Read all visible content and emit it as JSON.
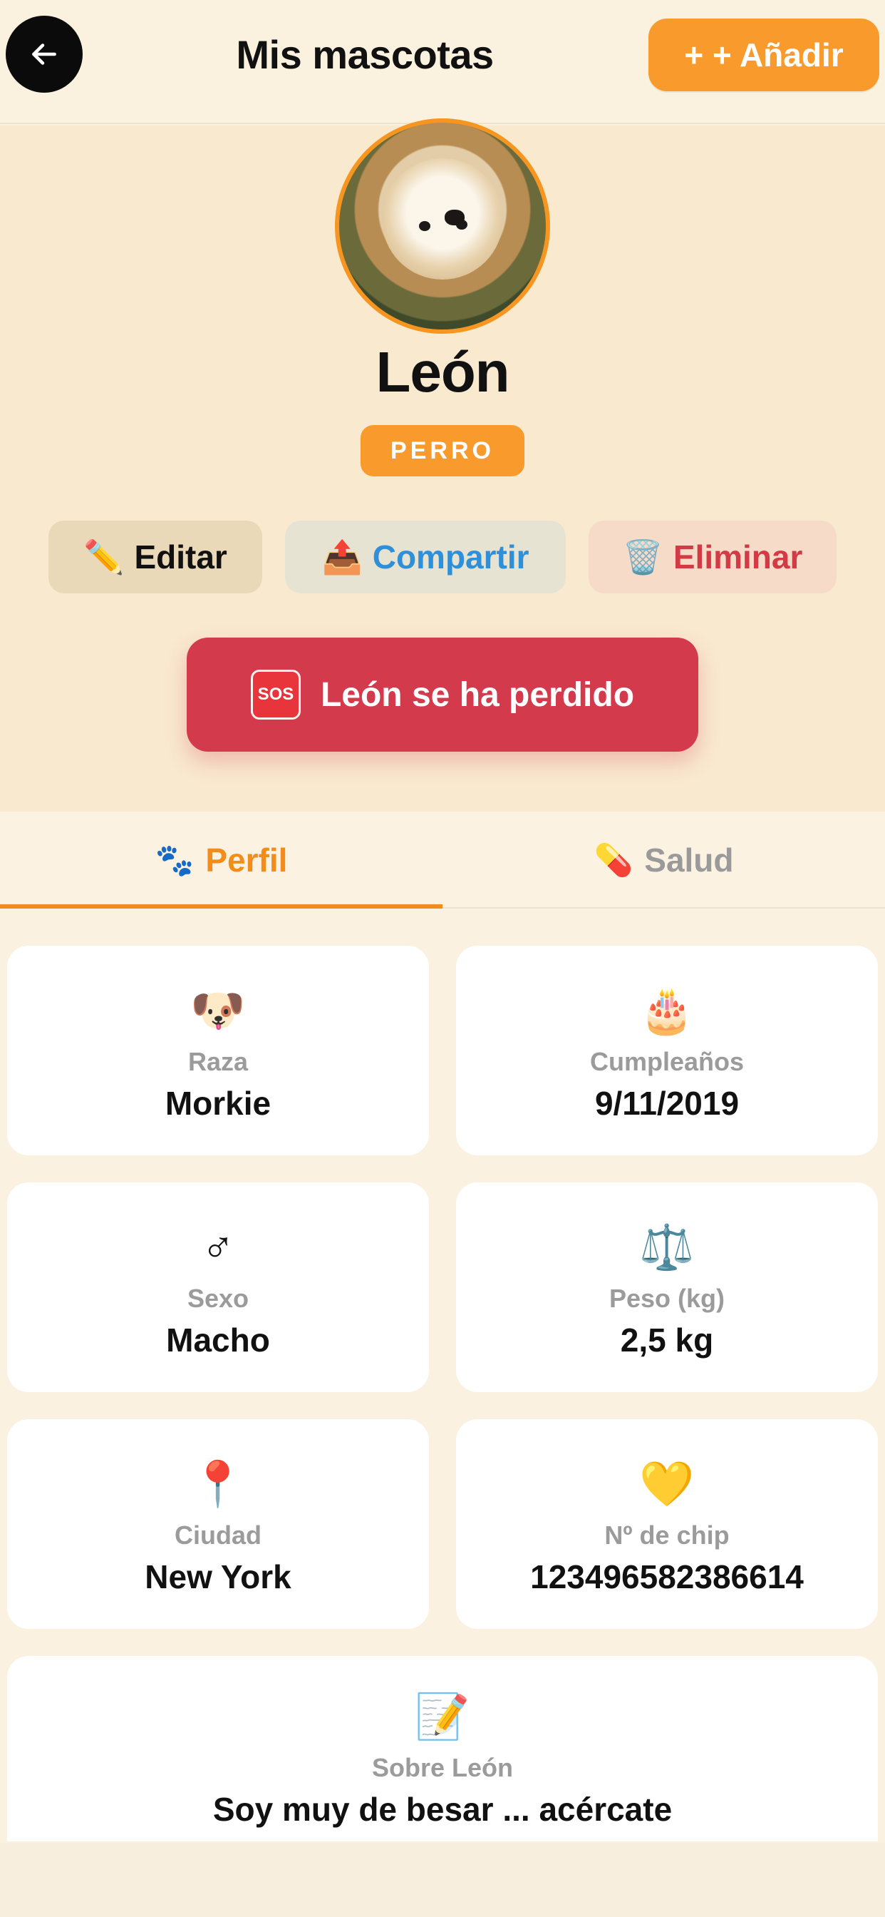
{
  "header": {
    "title": "Mis mascotas",
    "add_label": "+ + Añadir"
  },
  "pet": {
    "name": "León",
    "species": "PERRO"
  },
  "actions": {
    "edit": {
      "icon": "✏️",
      "label": "Editar"
    },
    "share": {
      "icon": "📤",
      "label": "Compartir"
    },
    "delete": {
      "icon": "🗑️",
      "label": "Eliminar"
    }
  },
  "sos": {
    "badge": "SOS",
    "label": "León  se ha perdido"
  },
  "tabs": [
    {
      "icon": "🐾",
      "label": "Perfil",
      "active": true
    },
    {
      "icon": "💊",
      "label": "Salud",
      "active": false
    }
  ],
  "profile": {
    "breed": {
      "icon": "🐶",
      "label": "Raza",
      "value": "Morkie"
    },
    "birthday": {
      "icon": "🎂",
      "label": "Cumpleaños",
      "value": "9/11/2019"
    },
    "sex": {
      "icon": "♂",
      "label": "Sexo",
      "value": "Macho"
    },
    "weight": {
      "icon": "⚖️",
      "label": "Peso (kg)",
      "value": "2,5 kg"
    },
    "city": {
      "icon": "📍",
      "label": "Ciudad",
      "value": "New York"
    },
    "chip": {
      "icon": "💛",
      "label": "Nº de chip",
      "value": "123496582386614"
    },
    "about": {
      "icon": "📝",
      "label": "Sobre León",
      "value": "Soy muy de besar ... acércate"
    }
  },
  "colors": {
    "accent": "#f89b2c",
    "sos": "#d33a4b",
    "share_text": "#2f8fd8",
    "delete_text": "#d23a45",
    "background": "#faf1e1"
  }
}
